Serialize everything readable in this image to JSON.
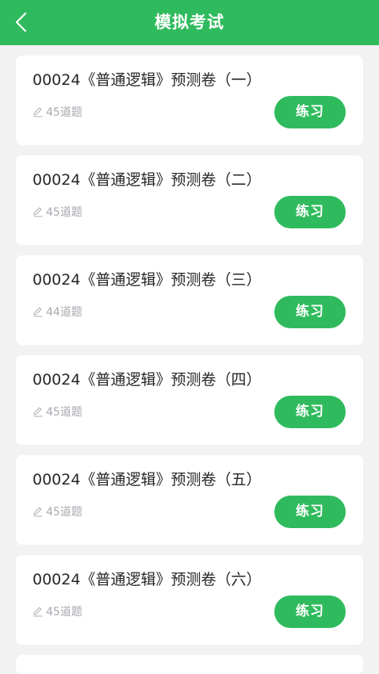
{
  "header": {
    "title": "模拟考试",
    "back_icon": "chevron-left-icon",
    "bg_color": "#2fbb5d"
  },
  "papers": [
    {
      "title": "00024《普通逻辑》预测卷（一）",
      "count": "45道题",
      "action": "练习"
    },
    {
      "title": "00024《普通逻辑》预测卷（二）",
      "count": "45道题",
      "action": "练习"
    },
    {
      "title": "00024《普通逻辑》预测卷（三）",
      "count": "44道题",
      "action": "练习"
    },
    {
      "title": "00024《普通逻辑》预测卷（四）",
      "count": "45道题",
      "action": "练习"
    },
    {
      "title": "00024《普通逻辑》预测卷（五）",
      "count": "45道题",
      "action": "练习"
    },
    {
      "title": "00024《普通逻辑》预测卷（六）",
      "count": "45道题",
      "action": "练习"
    }
  ],
  "icons": {
    "question_count": "pencil-icon"
  },
  "colors": {
    "accent": "#2fbb5d",
    "page_bg": "#f2f2f2",
    "meta_text": "#a9a9b0"
  }
}
